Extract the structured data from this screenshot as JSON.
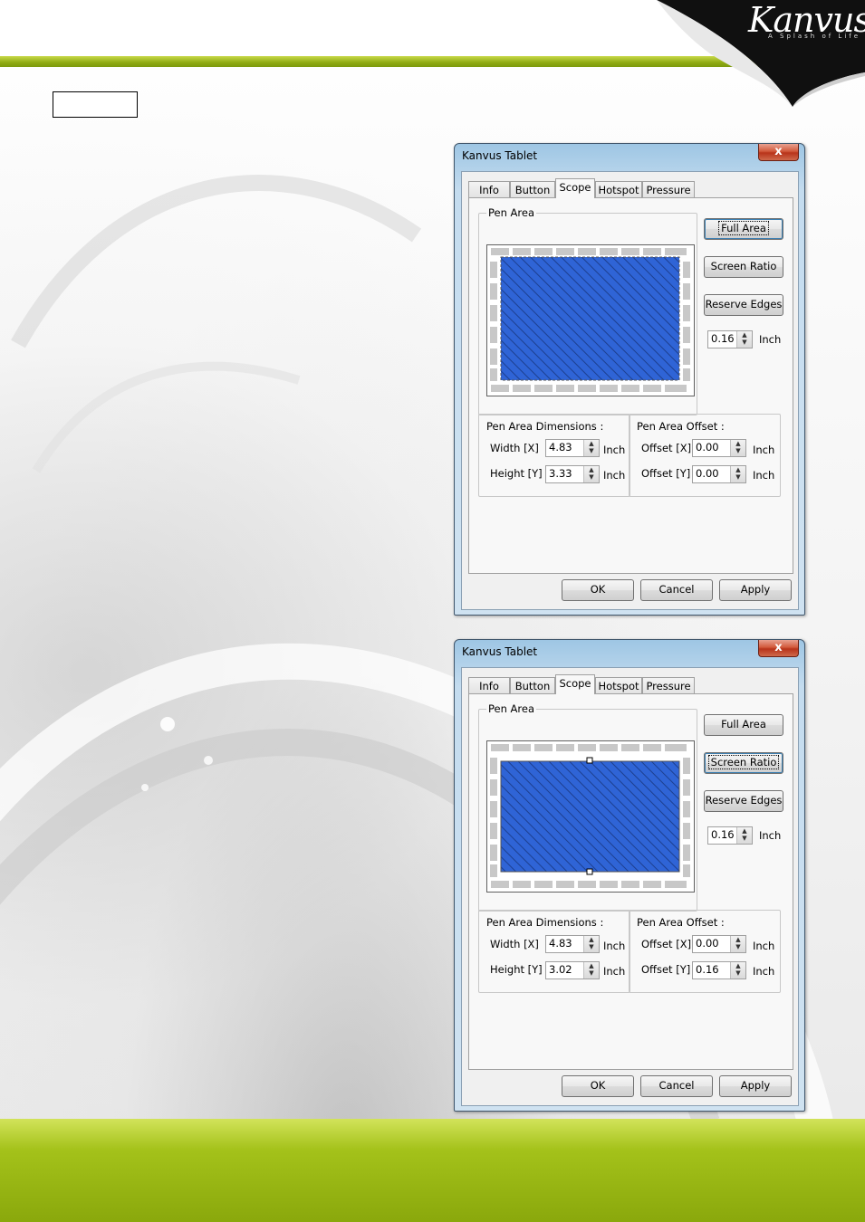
{
  "header": {
    "logo": "Kanvus",
    "tagline": "A Splash of Life"
  },
  "dialogs": [
    {
      "title": "Kanvus Tablet",
      "close_label": "x",
      "tabs": [
        "Info",
        "Button",
        "Scope",
        "Hotspot",
        "Pressure"
      ],
      "active_tab": "Scope",
      "pen_area_label": "Pen Area",
      "buttons": {
        "full_area": "Full Area",
        "screen_ratio": "Screen Ratio",
        "reserve_edges": "Reserve Edges"
      },
      "focused_button": "full_area",
      "edge_value": "0.16",
      "unit": "Inch",
      "dimensions_label": "Pen Area Dimensions :",
      "width_label": "Width [X]",
      "width_value": "4.83",
      "height_label": "Height [Y]",
      "height_value": "3.33",
      "offset_group_label": "Pen Area Offset :",
      "offset_x_label": "Offset [X]",
      "offset_x_value": "0.00",
      "offset_y_label": "Offset [Y]",
      "offset_y_value": "0.00",
      "footer": {
        "ok": "OK",
        "cancel": "Cancel",
        "apply": "Apply"
      }
    },
    {
      "title": "Kanvus Tablet",
      "close_label": "x",
      "tabs": [
        "Info",
        "Button",
        "Scope",
        "Hotspot",
        "Pressure"
      ],
      "active_tab": "Scope",
      "pen_area_label": "Pen Area",
      "buttons": {
        "full_area": "Full Area",
        "screen_ratio": "Screen Ratio",
        "reserve_edges": "Reserve Edges"
      },
      "focused_button": "screen_ratio",
      "edge_value": "0.16",
      "unit": "Inch",
      "dimensions_label": "Pen Area Dimensions :",
      "width_label": "Width [X]",
      "width_value": "4.83",
      "height_label": "Height [Y]",
      "height_value": "3.02",
      "offset_group_label": "Pen Area Offset :",
      "offset_x_label": "Offset [X]",
      "offset_x_value": "0.00",
      "offset_y_label": "Offset [Y]",
      "offset_y_value": "0.16",
      "footer": {
        "ok": "OK",
        "cancel": "Cancel",
        "apply": "Apply"
      }
    }
  ],
  "colors": {
    "accent_green": "#8faa12",
    "pen_area_blue": "#2f64d6"
  }
}
